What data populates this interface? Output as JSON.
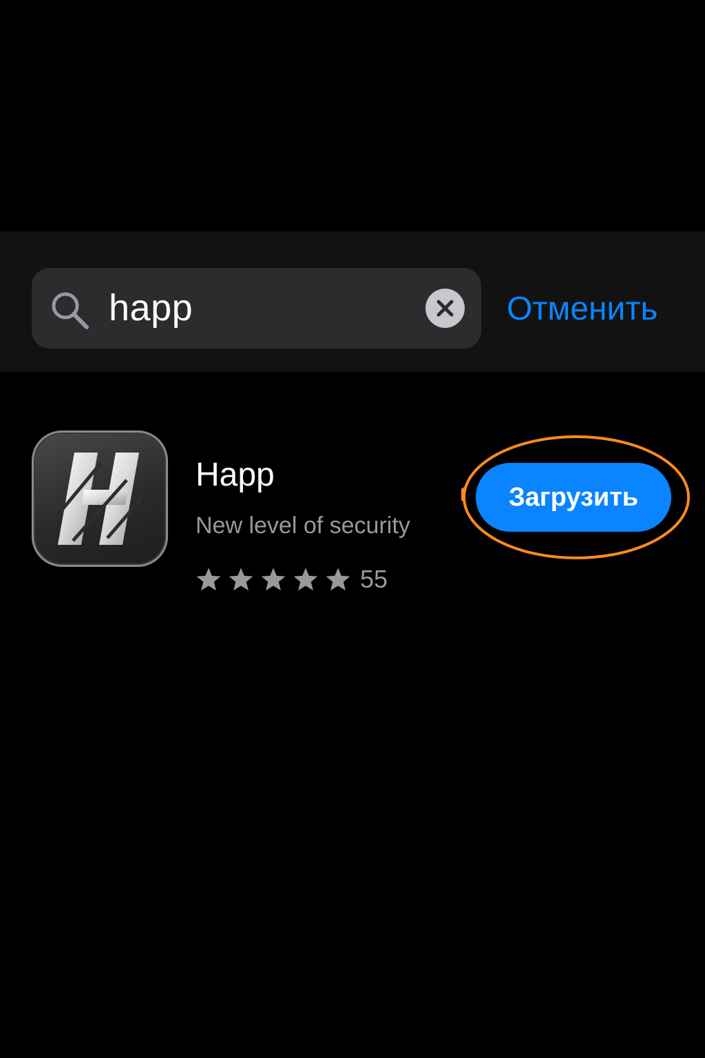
{
  "search": {
    "query": "happ",
    "cancel_label": "Отменить"
  },
  "result": {
    "app_name": "Happ",
    "subtitle": "New level of security",
    "rating_stars": 5,
    "rating_count": "55",
    "get_label": "Загрузить"
  },
  "icons": {
    "search": "search-icon",
    "clear": "close-icon",
    "app": "app-logo-icon",
    "star": "star-icon"
  },
  "colors": {
    "accent": "#0a84ff",
    "highlight": "#ff8a1f",
    "background": "#000000",
    "search_bar_bg": "#121212",
    "search_field_bg": "#2c2c2e",
    "secondary_text": "#98989f"
  }
}
